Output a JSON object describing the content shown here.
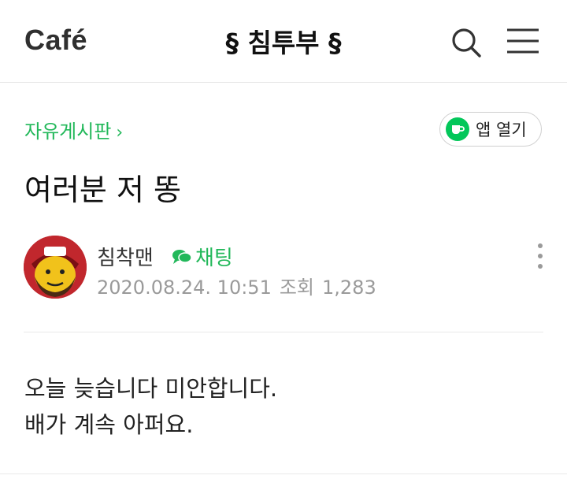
{
  "header": {
    "logo": "Café",
    "cafe_name": "§ 침투부 §",
    "icons": [
      "search-icon",
      "menu-icon"
    ]
  },
  "board": {
    "name": "자유게시판",
    "chevron": "›"
  },
  "app_button": {
    "label": "앱 열기",
    "icon": "cafe-cup-icon"
  },
  "post": {
    "title": "여러분 저 똥",
    "author": "침착맨",
    "chat_label": "채팅",
    "date": "2020.08.24. 10:51",
    "views_label": "조회",
    "views": "1,283",
    "body_line1": "오늘 늦습니다 미안합니다.",
    "body_line2": "배가 계속 아퍼요."
  },
  "colors": {
    "accent": "#22b85a",
    "brand_green": "#03c75a",
    "meta_gray": "#9a9a9a"
  }
}
